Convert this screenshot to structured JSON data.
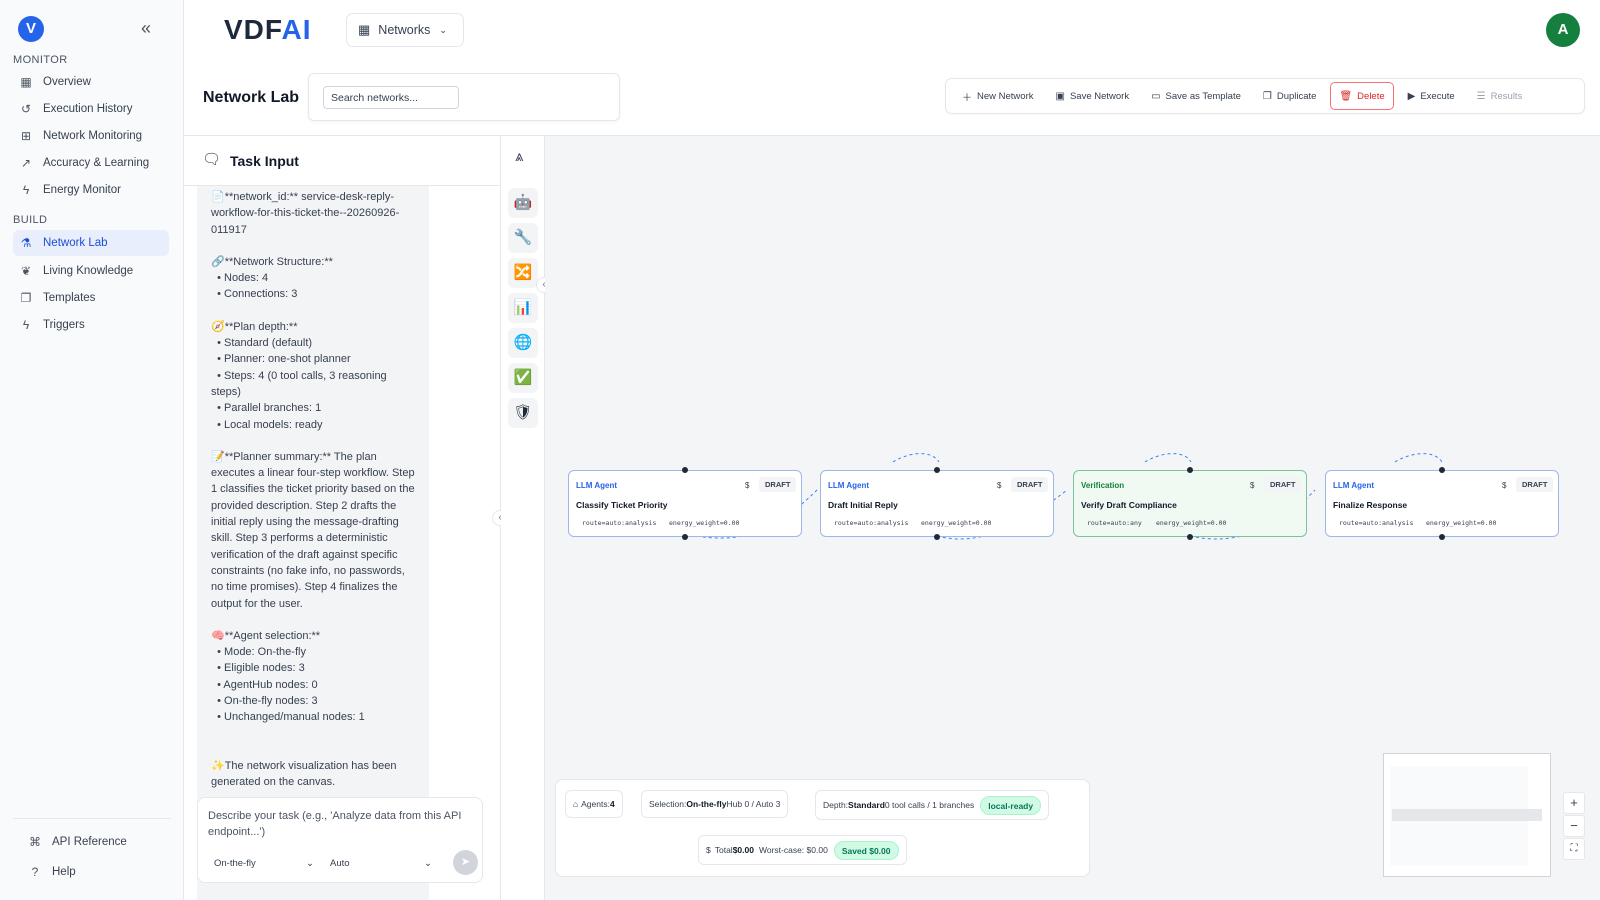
{
  "brand": {
    "name": "VDF",
    "ai": "AI"
  },
  "topbar": {
    "network_selector": "Networks",
    "avatar_initial": "A"
  },
  "sidebar": {
    "sections": {
      "monitor": "MONITOR",
      "build": "BUILD"
    },
    "monitor_items": [
      {
        "label": "Overview",
        "icon": "grid-icon"
      },
      {
        "label": "Execution History",
        "icon": "history-icon"
      },
      {
        "label": "Network Monitoring",
        "icon": "network-icon"
      },
      {
        "label": "Accuracy & Learning",
        "icon": "trend-icon"
      },
      {
        "label": "Energy Monitor",
        "icon": "bolt-icon"
      }
    ],
    "build_items": [
      {
        "label": "Network Lab",
        "icon": "flask-icon",
        "active": true
      },
      {
        "label": "Living Knowledge",
        "icon": "brain-icon"
      },
      {
        "label": "Templates",
        "icon": "copy-icon"
      },
      {
        "label": "Triggers",
        "icon": "bolt-icon"
      }
    ],
    "footer_items": [
      {
        "label": "API Reference",
        "icon": "code-icon"
      },
      {
        "label": "Help",
        "icon": "help-icon"
      }
    ]
  },
  "page": {
    "title": "Network Lab",
    "search_placeholder": "Search networks..."
  },
  "toolbar": {
    "new_network": "New Network",
    "save_network": "Save Network",
    "save_template": "Save as Template",
    "duplicate": "Duplicate",
    "delete": "Delete",
    "execute": "Execute",
    "results": "Results"
  },
  "task": {
    "title": "Task Input",
    "messages": [
      "📄**network_id:** service-desk-reply-workflow-for-this-ticket-the--20260926-011917",
      "🔗**Network Structure:**\n  • Nodes: 4\n  • Connections: 3",
      "🧭**Plan depth:**\n  • Standard (default)\n  • Planner: one-shot planner\n  • Steps: 4 (0 tool calls, 3 reasoning steps)\n  • Parallel branches: 1\n  • Local models: ready",
      "📝**Planner summary:** The plan executes a linear four-step workflow. Step 1 classifies the ticket priority based on the provided description. Step 2 drafts the initial reply using the message-drafting skill. Step 3 performs a deterministic verification of the draft against specific constraints (no fake info, no passwords, no time promises). Step 4 finalizes the output for the user.",
      "🧠**Agent selection:**\n  • Mode: On-the-fly\n  • Eligible nodes: 3\n  • AgentHub nodes: 0\n  • On-the-fly nodes: 3\n  • Unchanged/manual nodes: 1",
      "✨The network visualization has been generated on the canvas."
    ],
    "input_placeholder": "Describe your task (e.g., 'Analyze data from this API endpoint...')",
    "mode_select": "On-the-fly",
    "model_select": "Auto"
  },
  "palette": [
    {
      "icon": "robot-icon",
      "glyph": "🤖"
    },
    {
      "icon": "wrench-icon",
      "glyph": "🔧"
    },
    {
      "icon": "shuffle-icon",
      "glyph": "🔀"
    },
    {
      "icon": "bar-chart-icon",
      "glyph": "📊"
    },
    {
      "icon": "globe-icon",
      "glyph": "🌐"
    },
    {
      "icon": "check-box-icon",
      "glyph": "✅"
    },
    {
      "icon": "shield-icon",
      "glyph": "🛡"
    }
  ],
  "nodes": [
    {
      "kind": "LLM Agent",
      "title": "Classify Ticket Priority",
      "badge": "DRAFT",
      "cost": "$",
      "route": "route=auto:analysis",
      "energy": "energy_weight=0.00",
      "type": "llm"
    },
    {
      "kind": "LLM Agent",
      "title": "Draft Initial Reply",
      "badge": "DRAFT",
      "cost": "$",
      "route": "route=auto:analysis",
      "energy": "energy_weight=0.00",
      "type": "llm"
    },
    {
      "kind": "Verification",
      "title": "Verify Draft Compliance",
      "badge": "DRAFT",
      "cost": "$",
      "route": "route=auto:any",
      "energy": "energy_weight=0.00",
      "type": "verification"
    },
    {
      "kind": "LLM Agent",
      "title": "Finalize Response",
      "badge": "DRAFT",
      "cost": "$",
      "route": "route=auto:analysis",
      "energy": "energy_weight=0.00",
      "type": "llm"
    }
  ],
  "stats": {
    "agents_label": "Agents:",
    "agents_value": "4",
    "selection_label": "Selection:",
    "selection_value": "On-the-fly",
    "selection_hub": "Hub 0 / Auto 3",
    "depth_label": "Depth:",
    "depth_value": "Standard",
    "depth_detail": "0 tool calls / 1 branches",
    "depth_pill": "local-ready",
    "cost_icon": "$",
    "total_label": "Total",
    "total_value": "$0.00",
    "worst_case": "Worst-case: $0.00",
    "saved": "Saved $0.00"
  },
  "zoom": {
    "in": "+",
    "out": "−",
    "fit": "⛶"
  },
  "colors": {
    "accent": "#2563eb",
    "avatar": "#15803d",
    "danger": "#dc2626",
    "verification": "#15803d",
    "ready": "#047857"
  }
}
